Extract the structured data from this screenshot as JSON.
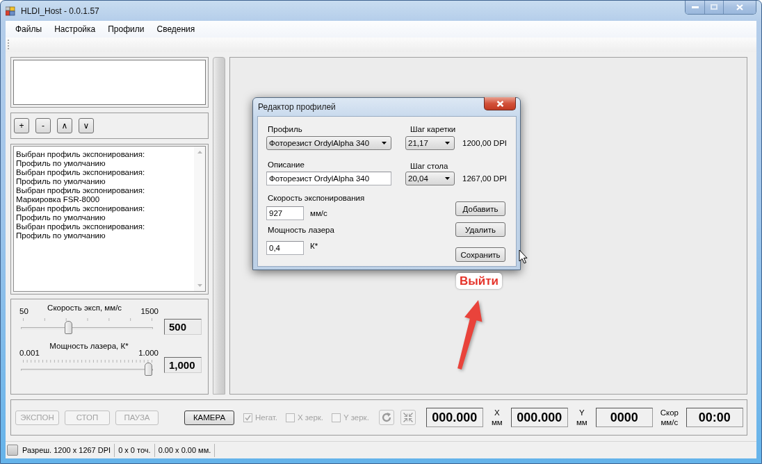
{
  "window": {
    "title": "HLDI_Host - 0.0.1.57"
  },
  "menu": [
    "Файлы",
    "Настройка",
    "Профили",
    "Сведения"
  ],
  "list_buttons": [
    "+",
    "-",
    "∧",
    "∨"
  ],
  "log": [
    "Выбран профиль экспонирования:",
    "Профиль по умолчанию",
    "Выбран профиль экспонирования:",
    "Профиль по умолчанию",
    "Выбран профиль экспонирования:",
    "Маркировка FSR-8000",
    "Выбран профиль экспонирования:",
    "Профиль по умолчанию",
    "Выбран профиль экспонирования:",
    "Профиль по умолчанию"
  ],
  "sliders": [
    {
      "label": "Скорость эксп, мм/с",
      "min": "50",
      "max": "1500",
      "level": 0.34,
      "value": "500"
    },
    {
      "label": "Мощность лазера, К*",
      "min": "0.001",
      "max": "1.000",
      "level": 1,
      "value": "1,000"
    }
  ],
  "bottom_bar": {
    "buttons": [
      {
        "label": "ЭКСПОН",
        "disabled": true
      },
      {
        "label": "СТОП",
        "disabled": true
      },
      {
        "label": "ПАУЗА",
        "disabled": true
      },
      {
        "label": "КАМЕРА",
        "disabled": false
      }
    ],
    "checkboxes": [
      {
        "label": "Негат.",
        "checked": true,
        "disabled": true
      },
      {
        "label": "X зерк.",
        "checked": false,
        "disabled": true
      },
      {
        "label": "Y зерк.",
        "checked": false,
        "disabled": true
      }
    ],
    "tool_buttons": [
      {
        "kind": "refresh",
        "disabled": true
      },
      {
        "kind": "collapse",
        "disabled": true
      }
    ],
    "readouts": [
      {
        "value": "000.000",
        "caption": [
          "X",
          "мм"
        ]
      },
      {
        "value": "000.000",
        "caption": [
          "Y",
          "мм"
        ]
      },
      {
        "value": "0000",
        "caption": [
          "Скор",
          "мм/с"
        ]
      },
      {
        "value": "00:00"
      }
    ]
  },
  "status_bar": [
    "Разреш. 1200 x 1267 DPI",
    "0 x 0 точ.",
    "0.00 x 0.00 мм."
  ],
  "dialog": {
    "title": "Редактор профилей",
    "profile": {
      "label": "Профиль",
      "value": "Фоторезист OrdylAlpha 340"
    },
    "carriage_step": {
      "label": "Шаг каретки",
      "value": "21,17",
      "reading": "1200,00 DPI"
    },
    "description": {
      "label": "Описание",
      "value": "Фоторезист OrdylAlpha 340"
    },
    "table_step": {
      "label": "Шаг стола",
      "value": "20,04",
      "reading": "1267,00 DPI"
    },
    "speed": {
      "label": "Скорость экспонирования",
      "value": "927",
      "unit": "мм/с"
    },
    "laser_power": {
      "label": "Мощность лазера",
      "value": "0,4",
      "unit": "К*"
    },
    "buttons": [
      "Добавить",
      "Удалить",
      "Сохранить"
    ]
  },
  "annotation": {
    "text": "Выйти"
  }
}
